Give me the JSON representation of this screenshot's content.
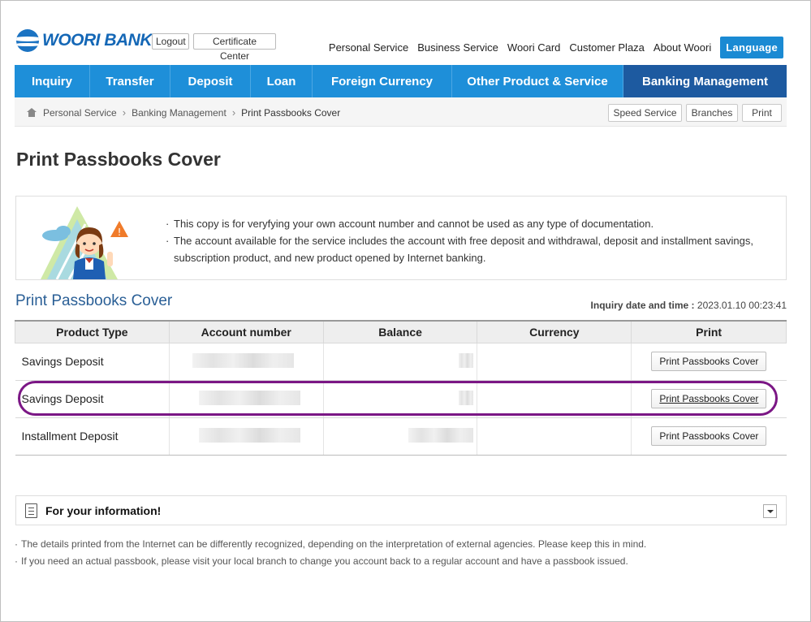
{
  "header": {
    "logo_text": "WOORI BANK",
    "logout_label": "Logout",
    "certificate_label": "Certificate Center",
    "topnav": [
      "Personal Service",
      "Business Service",
      "Woori Card",
      "Customer Plaza",
      "About Woori"
    ],
    "language_label": "Language"
  },
  "mainnav": {
    "items": [
      "Inquiry",
      "Transfer",
      "Deposit",
      "Loan",
      "Foreign Currency",
      "Other Product & Service",
      "Banking Management"
    ],
    "active": "Banking Management"
  },
  "breadcrumb": {
    "items": [
      "Personal Service",
      "Banking Management",
      "Print Passbooks Cover"
    ],
    "buttons": [
      "Speed Service",
      "Branches",
      "Print"
    ]
  },
  "page_title": "Print Passbooks Cover",
  "notice": [
    "This copy is for veryfying your own account number and cannot be used as any type of documentation.",
    "The account available for the service includes the account with free deposit and withdrawal, deposit and installment savings, subscription product, and new product opened by Internet banking."
  ],
  "section_title": "Print Passbooks Cover",
  "inquiry": {
    "label": "Inquiry date and time :",
    "value": "2023.01.10 00:23:41"
  },
  "table": {
    "headers": [
      "Product Type",
      "Account number",
      "Balance",
      "Currency",
      "Print"
    ],
    "rows": [
      {
        "product": "Savings Deposit",
        "button": "Print Passbooks Cover"
      },
      {
        "product": "Savings Deposit",
        "button": "Print Passbooks Cover"
      },
      {
        "product": "Installment Deposit",
        "button": "Print Passbooks Cover"
      }
    ]
  },
  "info": {
    "title": "For your information!",
    "notes": [
      "The details printed from the Internet can be differently recognized, depending on the interpretation of external agencies. Please keep this in mind.",
      "If you need an actual passbook, please visit your local branch to change you account back to a regular account and have a passbook issued."
    ]
  },
  "colors": {
    "nav_blue": "#1e8fd9",
    "nav_active": "#1d5aa0",
    "highlight": "#7b1785",
    "title_blue": "#2a5f96"
  }
}
